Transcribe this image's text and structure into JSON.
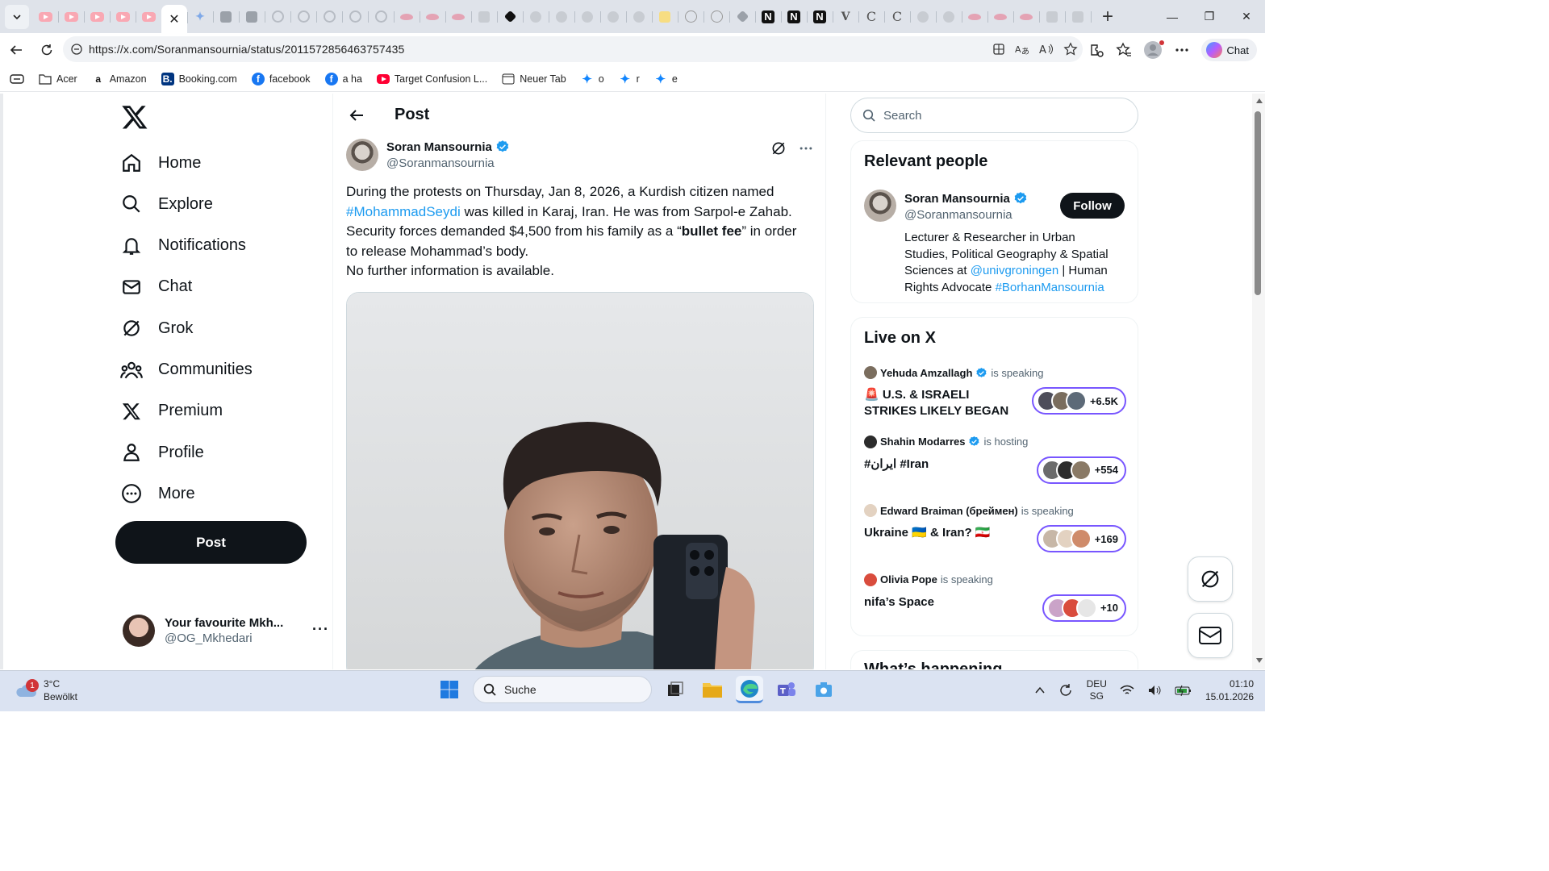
{
  "browser": {
    "tabs": [
      {
        "icon": "youtube-icon"
      },
      {
        "icon": "youtube-icon"
      },
      {
        "icon": "youtube-icon"
      },
      {
        "icon": "youtube-icon"
      },
      {
        "icon": "youtube-icon"
      },
      {
        "icon": "close-icon",
        "active": true
      },
      {
        "icon": "bluesky-icon"
      },
      {
        "icon": "gallery-icon"
      },
      {
        "icon": "gallery-icon"
      },
      {
        "icon": "google-icon"
      },
      {
        "icon": "google-icon"
      },
      {
        "icon": "google-icon"
      },
      {
        "icon": "google-icon"
      },
      {
        "icon": "google-icon"
      },
      {
        "icon": "lips-icon"
      },
      {
        "icon": "lips-icon"
      },
      {
        "icon": "lips-icon"
      },
      {
        "icon": "page-icon"
      },
      {
        "icon": "diamond-icon"
      },
      {
        "icon": "figure-icon"
      },
      {
        "icon": "figure-icon"
      },
      {
        "icon": "figure-icon"
      },
      {
        "icon": "figure-icon"
      },
      {
        "icon": "figure-icon"
      },
      {
        "icon": "note-icon"
      },
      {
        "icon": "globe-icon"
      },
      {
        "icon": "globe-icon"
      },
      {
        "icon": "puzzle-icon"
      },
      {
        "icon": "notion-icon",
        "letter": "N"
      },
      {
        "icon": "notion-icon",
        "letter": "N"
      },
      {
        "icon": "notion-icon",
        "letter": "N"
      },
      {
        "icon": "v-icon",
        "letter": "V"
      },
      {
        "icon": "c-icon",
        "letter": "C"
      },
      {
        "icon": "c-icon",
        "letter": "C"
      },
      {
        "icon": "figure-icon"
      },
      {
        "icon": "figure-icon"
      },
      {
        "icon": "lips-icon"
      },
      {
        "icon": "lips-icon"
      },
      {
        "icon": "lips-icon"
      },
      {
        "icon": "page-icon"
      },
      {
        "icon": "page-icon"
      }
    ],
    "url": "https://x.com/Soranmansournia/status/2011572856463757435",
    "copilot_label": "Chat",
    "bookmarks": [
      {
        "label": "Acer",
        "icon": "folder-icon"
      },
      {
        "label": "Amazon",
        "icon": "amazon-icon",
        "glyph": "a"
      },
      {
        "label": "Booking.com",
        "icon": "booking-icon",
        "glyph": "B."
      },
      {
        "label": "facebook",
        "icon": "facebook-icon",
        "glyph": "f"
      },
      {
        "label": "a ha",
        "icon": "facebook-icon",
        "glyph": "f"
      },
      {
        "label": "Target Confusion L...",
        "icon": "youtube-icon"
      },
      {
        "label": "Neuer Tab",
        "icon": "newtab-icon"
      },
      {
        "label": "o",
        "icon": "bluesky-icon"
      },
      {
        "label": "r",
        "icon": "bluesky-icon"
      },
      {
        "label": "e",
        "icon": "bluesky-icon"
      }
    ]
  },
  "x": {
    "nav": [
      {
        "label": "Home",
        "icon": "home-icon"
      },
      {
        "label": "Explore",
        "icon": "search-icon"
      },
      {
        "label": "Notifications",
        "icon": "bell-icon"
      },
      {
        "label": "Chat",
        "icon": "mail-icon"
      },
      {
        "label": "Grok",
        "icon": "grok-icon"
      },
      {
        "label": "Communities",
        "icon": "communities-icon"
      },
      {
        "label": "Premium",
        "icon": "x-logo-icon"
      },
      {
        "label": "Profile",
        "icon": "person-icon"
      },
      {
        "label": "More",
        "icon": "more-circle-icon"
      }
    ],
    "post_button": "Post",
    "account": {
      "name": "Your favourite Mkh...",
      "handle": "@OG_Mkhedari"
    },
    "header_title": "Post",
    "post": {
      "author_name": "Soran Mansournia",
      "author_handle": "@Soranmansournia",
      "text_1": "During the protests on Thursday, Jan 8, 2026, a Kurdish citizen named ",
      "hashtag": "#MohammadSeydi",
      "text_2": " was killed in Karaj, Iran. He was from Sarpol-e Zahab. Security forces demanded $4,500 from his family as a “",
      "bold": "bullet fee",
      "text_3": "” in order to release Mohammad’s body.",
      "text_4": "No further information is available."
    },
    "search_placeholder": "Search",
    "relevant": {
      "title": "Relevant people",
      "name": "Soran Mansournia",
      "handle": "@Soranmansournia",
      "follow": "Follow",
      "bio_1": "Lecturer & Researcher in Urban Studies, Political Geography & Spatial Sciences at ",
      "bio_link": "@univgroningen",
      "bio_2": " | Human Rights Advocate ",
      "bio_tag": "#BorhanMansournia"
    },
    "live": {
      "title": "Live on X",
      "spaces": [
        {
          "host": "Yehuda Amzallagh",
          "verified": true,
          "status": "is speaking",
          "title": "🚨 U.S. & ISRAELI STRIKES LIKELY BEGAN",
          "count": "+6.5K"
        },
        {
          "host": "Shahin Modarres",
          "verified": true,
          "status": "is hosting",
          "title": "#ایران #Iran",
          "count": "+554"
        },
        {
          "host": "Edward Braiman (бреймен)",
          "verified": false,
          "status": "is speaking",
          "title": "Ukraine 🇺🇦 & Iran? 🇮🇷",
          "count": "+169"
        },
        {
          "host": "Olivia Pope",
          "verified": false,
          "status": "is speaking",
          "title": "nifa’s Space",
          "count": "+10"
        }
      ]
    },
    "whats_happening": "What’s happening"
  },
  "taskbar": {
    "badge": "1",
    "temp": "3°C",
    "weather": "Bewölkt",
    "search": "Suche",
    "lang_1": "DEU",
    "lang_2": "SG",
    "time": "01:10",
    "date": "15.01.2026"
  },
  "colors": {
    "accent": "#1d9bf0",
    "text": "#0f1419",
    "muted": "#536471",
    "spaces": "#7856ff"
  }
}
